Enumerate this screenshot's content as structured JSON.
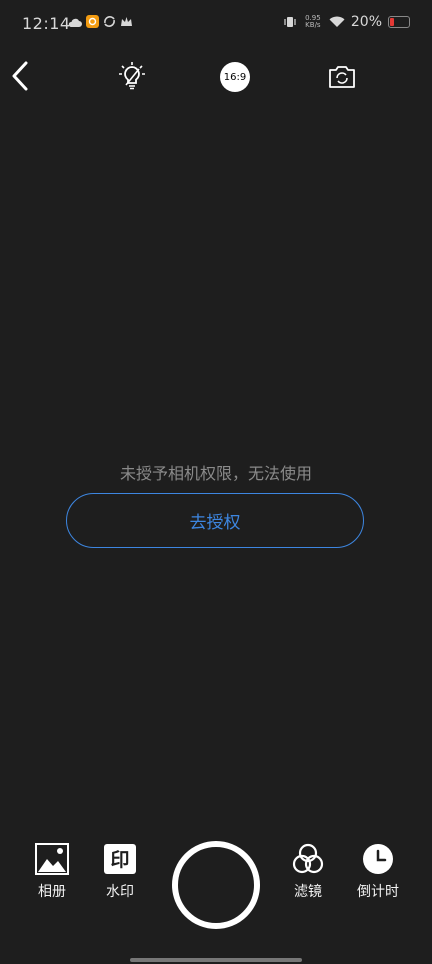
{
  "status_bar": {
    "time": "12:14",
    "net_speed_line1": "0.95",
    "net_speed_line2": "KB/s",
    "battery_percent": "20%",
    "battery_color": "#e53935"
  },
  "toolbar": {
    "back_icon": "chevron-left",
    "flash_icon": "bulb-flash-off",
    "aspect_ratio": "16:9",
    "switch_camera_icon": "camera-switch"
  },
  "permission": {
    "message": "未授予相机权限，无法使用",
    "button_label": "去授权",
    "accent_color": "#3d86e0"
  },
  "bottom_bar": {
    "album_label": "相册",
    "watermark_label": "水印",
    "watermark_glyph": "印",
    "filter_label": "滤镜",
    "timer_label": "倒计时"
  }
}
